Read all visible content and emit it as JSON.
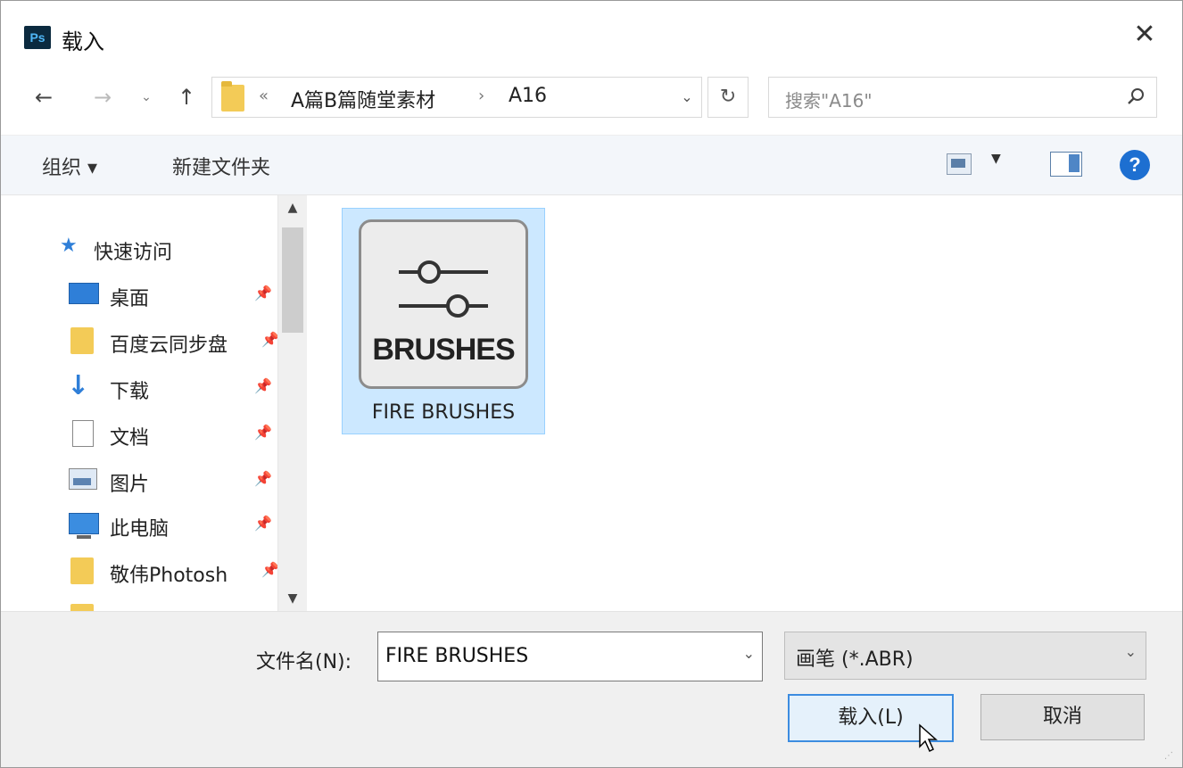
{
  "window": {
    "app_icon": "Ps",
    "title": "载入"
  },
  "address_bar": {
    "overflow": "«",
    "breadcrumbs": [
      "A篇B篇随堂素材",
      "A16"
    ],
    "separator": "›"
  },
  "search": {
    "placeholder": "搜索\"A16\""
  },
  "toolbar": {
    "organize_label": "组织 ▾",
    "new_folder_label": "新建文件夹"
  },
  "nav_pane": {
    "quick_access": "快速访问",
    "items": [
      {
        "label": "桌面",
        "icon": "desktop-icon"
      },
      {
        "label": "百度云同步盘",
        "icon": "folder-icon"
      },
      {
        "label": "下载",
        "icon": "download-icon"
      },
      {
        "label": "文档",
        "icon": "document-icon"
      },
      {
        "label": "图片",
        "icon": "pictures-icon"
      },
      {
        "label": "此电脑",
        "icon": "computer-icon"
      },
      {
        "label": "敬伟Photosh",
        "icon": "folder-icon"
      }
    ]
  },
  "files": [
    {
      "name": "FIRE BRUSHES",
      "icon_text": "BRUSHES",
      "selected": true
    }
  ],
  "footer": {
    "filename_label": "文件名(N):",
    "filename_value": "FIRE BRUSHES",
    "filetype_value": "画笔 (*.ABR)",
    "load_button": "载入(L)",
    "cancel_button": "取消"
  },
  "colors": {
    "selection_bg": "#cce8ff",
    "accent": "#1d6fd1",
    "folder": "#f3cb57"
  }
}
